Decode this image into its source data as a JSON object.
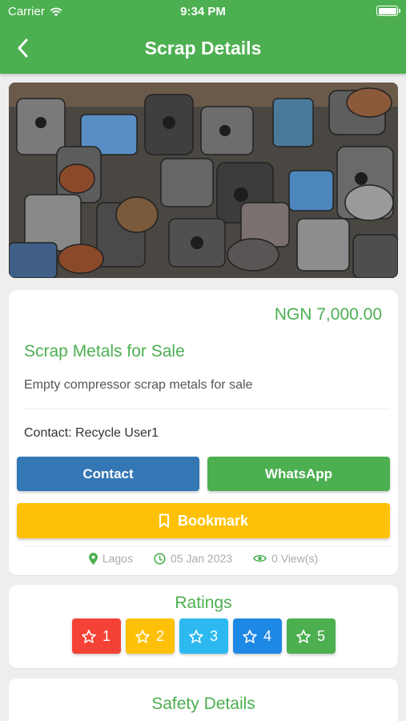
{
  "status_bar": {
    "carrier": "Carrier",
    "time": "9:34 PM"
  },
  "nav": {
    "title": "Scrap Details",
    "back_icon": "chevron-left-icon"
  },
  "listing": {
    "image_alt": "pile of scrap compressor metals",
    "price": "NGN 7,000.00",
    "title": "Scrap Metals for Sale",
    "description": "Empty compressor scrap metals for sale",
    "contact_text": "Contact: Recycle User1",
    "location": "Lagos",
    "date": "05 Jan 2023",
    "views": "0 View(s)"
  },
  "actions": {
    "contact_label": "Contact",
    "whatsapp_label": "WhatsApp",
    "bookmark_label": "Bookmark"
  },
  "ratings": {
    "title": "Ratings",
    "options": [
      {
        "label": "1",
        "color": "#f44336"
      },
      {
        "label": "2",
        "color": "#ffc107"
      },
      {
        "label": "3",
        "color": "#2bb9f0"
      },
      {
        "label": "4",
        "color": "#1e88e5"
      },
      {
        "label": "5",
        "color": "#4caf50"
      }
    ]
  },
  "safety": {
    "title": "Safety Details"
  },
  "colors": {
    "primary": "#4caf50",
    "contact": "#3477b5",
    "bookmark": "#ffc107"
  }
}
